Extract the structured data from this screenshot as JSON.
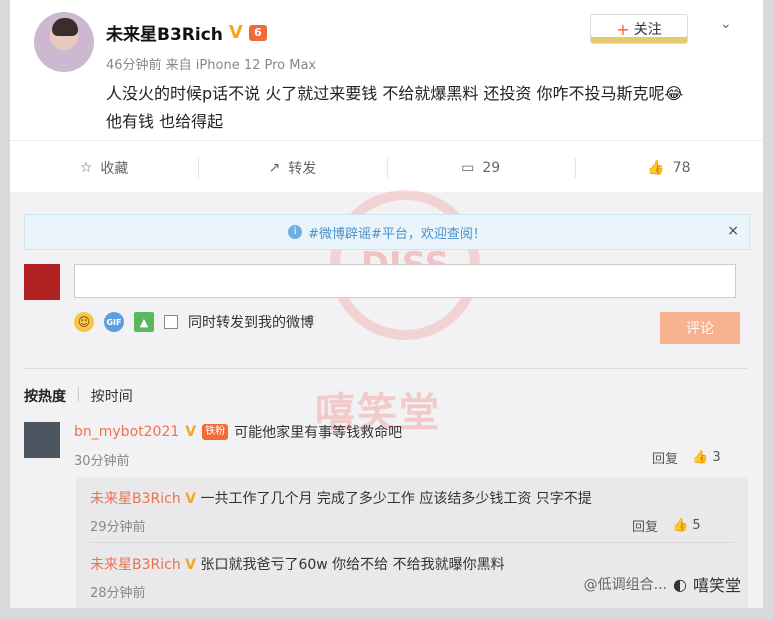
{
  "post": {
    "username": "未来星B3Rich",
    "v_badge": "V",
    "level_badge": "6",
    "meta": "46分钟前 来自 iPhone 12 Pro Max",
    "content_line1": "人没火的时候p话不说 火了就过来要钱 不给就爆黑料 还投资 你咋不投马斯克呢😂",
    "content_line2": "他有钱 也给得起",
    "follow_plus": "+",
    "follow_label": "关注",
    "more_chevron": "⌄"
  },
  "actions": {
    "favorite": "收藏",
    "forward": "转发",
    "comments": "29",
    "likes": "78"
  },
  "notice": {
    "text": "#微博辟谣#平台，欢迎查阅！",
    "close": "×"
  },
  "composer": {
    "sync_label": "同时转发到我的微博",
    "submit_label": "评论",
    "gif_label": "GIF"
  },
  "sort": {
    "hot": "按热度",
    "time": "按时间",
    "separator": "|"
  },
  "comments": [
    {
      "user": "bn_mybot2021",
      "badge": "V",
      "fan_badge": "铁粉",
      "text": "可能他家里有事等钱救命吧",
      "time": "30分钟前",
      "reply": "回复",
      "likes": "3"
    }
  ],
  "replies": [
    {
      "user": "未来星B3Rich",
      "badge": "V",
      "text": "一共工作了几个月 完成了多少工作 应该结多少钱工资 只字不提",
      "time": "29分钟前",
      "reply": "回复",
      "likes": "5"
    },
    {
      "user": "未来星B3Rich",
      "badge": "V",
      "text": "张口就我爸亏了60w 你给不给 不给我就曝你黑料",
      "time": "28分钟前"
    }
  ],
  "watermark": {
    "logo": "DISS",
    "text": "嘻笑堂"
  },
  "credit": {
    "weibo": "@低调组合...",
    "account": "嘻笑堂"
  },
  "colors": {
    "accent": "#eb7350",
    "submit": "#f8b18e",
    "notice_bg": "#eaf4fb"
  }
}
